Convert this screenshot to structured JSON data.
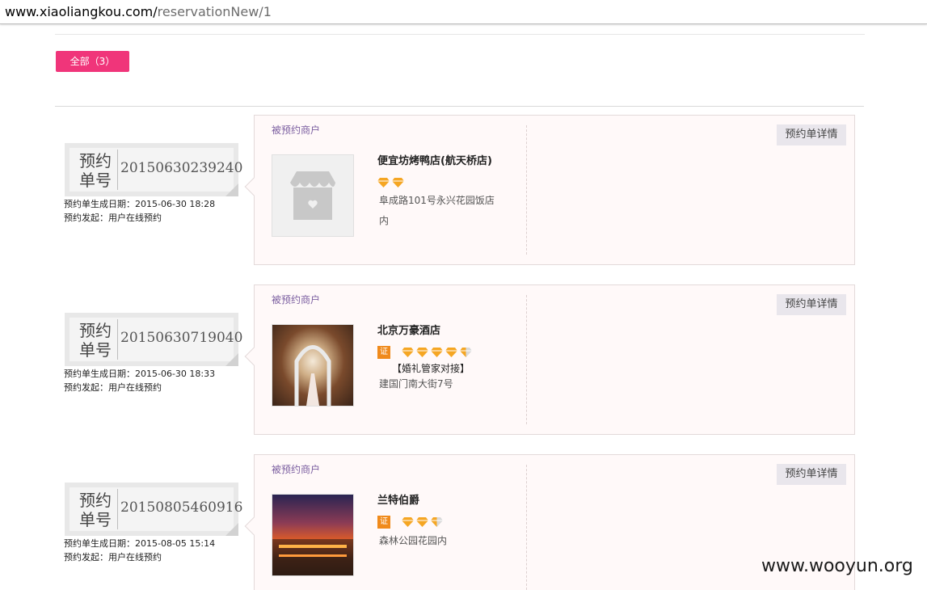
{
  "browser": {
    "url_host": "www.xiaoliangkou.com/",
    "url_path": "reservationNew/1"
  },
  "filter": {
    "label": "全部（3）"
  },
  "labels": {
    "ticket_label": "预约单号",
    "created_prefix": "预约单生成日期：",
    "origin_prefix": "预约发起：",
    "caption": "被预约商户",
    "detail_button": "预约单详情",
    "cert": "证"
  },
  "reservations": [
    {
      "number": "20150630239240",
      "created": "2015-06-30 18:28",
      "origin": "用户在线预约",
      "shop": {
        "name": "便宜坊烤鸭店(航天桥店)",
        "image": "store-placeholder-icon",
        "certified": false,
        "diamonds": 2,
        "address": "阜成路101号永兴花园饭店内",
        "tag": ""
      }
    },
    {
      "number": "20150630719040",
      "created": "2015-06-30 18:33",
      "origin": "用户在线预约",
      "shop": {
        "name": "北京万豪酒店",
        "image": "wedding-hall-photo",
        "certified": true,
        "diamonds": 4.5,
        "address": "建国门南大街7号",
        "tag": "【婚礼管家对接】"
      }
    },
    {
      "number": "20150805460916",
      "created": "2015-08-05 15:14",
      "origin": "用户在线预约",
      "shop": {
        "name": "兰特伯爵",
        "image": "restaurant-exterior-photo",
        "certified": true,
        "diamonds": 2.5,
        "address": "森林公园花园内",
        "tag": ""
      }
    }
  ],
  "watermark": "www.wooyun.org",
  "colors": {
    "accent": "#f0357a",
    "caption": "#7b5ea0",
    "diamond": "#f5a623",
    "cert": "#f08a1b"
  }
}
